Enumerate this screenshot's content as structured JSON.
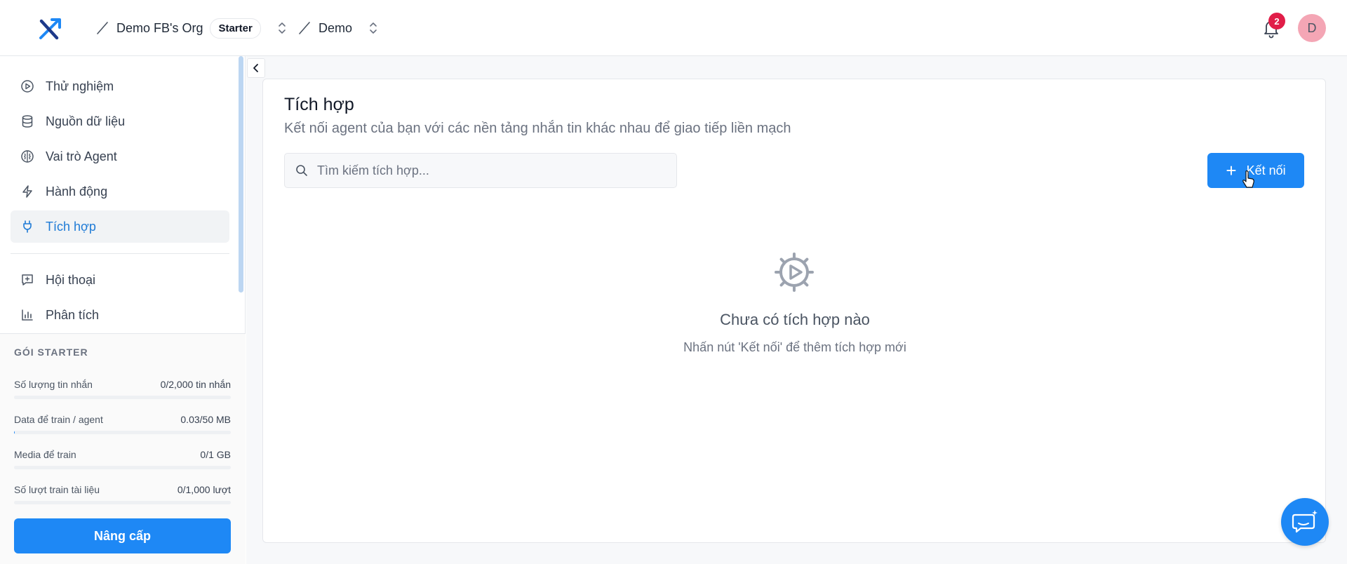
{
  "header": {
    "org_name": "Demo FB's Org",
    "plan_badge": "Starter",
    "project_name": "Demo",
    "notification_count": "2",
    "avatar_initial": "D"
  },
  "sidebar": {
    "items": [
      {
        "label": "Thử nghiệm",
        "icon": "play-circle-icon"
      },
      {
        "label": "Nguồn dữ liệu",
        "icon": "database-icon"
      },
      {
        "label": "Vai trò Agent",
        "icon": "brain-icon"
      },
      {
        "label": "Hành động",
        "icon": "lightning-icon"
      },
      {
        "label": "Tích hợp",
        "icon": "plug-icon",
        "active": true
      },
      {
        "label": "Hội thoại",
        "icon": "message-plus-icon"
      },
      {
        "label": "Phân tích",
        "icon": "bar-chart-icon"
      }
    ],
    "plan": {
      "title": "GÓI STARTER",
      "usage": [
        {
          "label": "Số lượng tin nhắn",
          "value": "0/2,000 tin nhắn",
          "fraction": 0
        },
        {
          "label": "Data để train / agent",
          "value": "0.03/50 MB",
          "fraction": 0.0006
        },
        {
          "label": "Media để train",
          "value": "0/1 GB",
          "fraction": 0
        },
        {
          "label": "Số lượt train tài liệu",
          "value": "0/1,000 lượt",
          "fraction": 0
        }
      ],
      "upgrade_label": "Nâng cấp"
    }
  },
  "main": {
    "title": "Tích hợp",
    "subtitle": "Kết nối agent của bạn với các nền tảng nhắn tin khác nhau để giao tiếp liền mạch",
    "search_placeholder": "Tìm kiếm tích hợp...",
    "connect_label": "Kết nối",
    "empty_title": "Chưa có tích hợp nào",
    "empty_desc": "Nhấn nút 'Kết nối' để thêm tích hợp mới"
  },
  "colors": {
    "accent": "#1e88f5",
    "active_text": "#1f7bd6",
    "notification": "#e11d48",
    "avatar_bg": "#f4a6b5"
  }
}
